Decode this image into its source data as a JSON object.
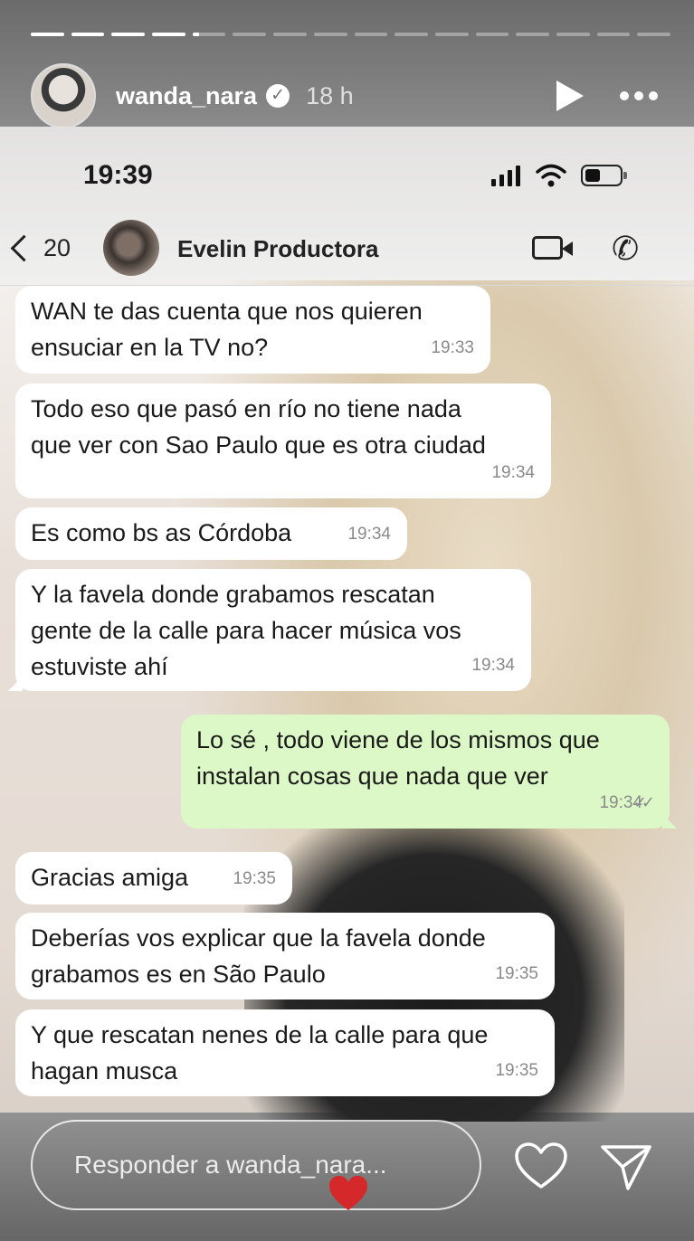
{
  "story": {
    "username": "wanda_nara",
    "time_ago": "18 h",
    "progress": [
      1,
      1,
      1,
      1,
      0.2,
      0,
      0,
      0,
      0,
      0,
      0,
      0,
      0,
      0,
      0,
      0
    ],
    "reply_placeholder": "Responder a wanda_nara..."
  },
  "phone": {
    "clock": "19:39",
    "chat": {
      "back_count": "20",
      "contact_name": "Evelin Productora"
    },
    "messages": [
      {
        "direction": "in",
        "text": "WAN te das cuenta que nos quieren\nensuciar en la TV no?",
        "time": "19:33"
      },
      {
        "direction": "in",
        "text": "Todo eso que pasó en río no tiene nada\nque ver con Sao Paulo que es otra ciudad",
        "time": "19:34"
      },
      {
        "direction": "in",
        "text": "Es como bs as Córdoba",
        "time": "19:34"
      },
      {
        "direction": "in",
        "text": "Y la favela donde grabamos rescatan\ngente de la calle para hacer música vos\nestuviste ahí",
        "time": "19:34"
      },
      {
        "direction": "out",
        "text": "Lo sé , todo viene de los mismos que\ninstalan cosas que nada que ver",
        "time": "19:34"
      },
      {
        "direction": "in",
        "text": "Gracias amiga",
        "time": "19:35"
      },
      {
        "direction": "in",
        "text": "Deberías vos explicar que la favela donde\ngrabamos es en São Paulo",
        "time": "19:35"
      },
      {
        "direction": "in",
        "text": "Y que rescatan nenes de la calle para que\nhagan musca",
        "time": "19:35"
      }
    ]
  },
  "colors": {
    "incoming_bubble": "#ffffff",
    "outgoing_bubble": "#dcf8c6",
    "floating_heart": "#d4282a"
  }
}
